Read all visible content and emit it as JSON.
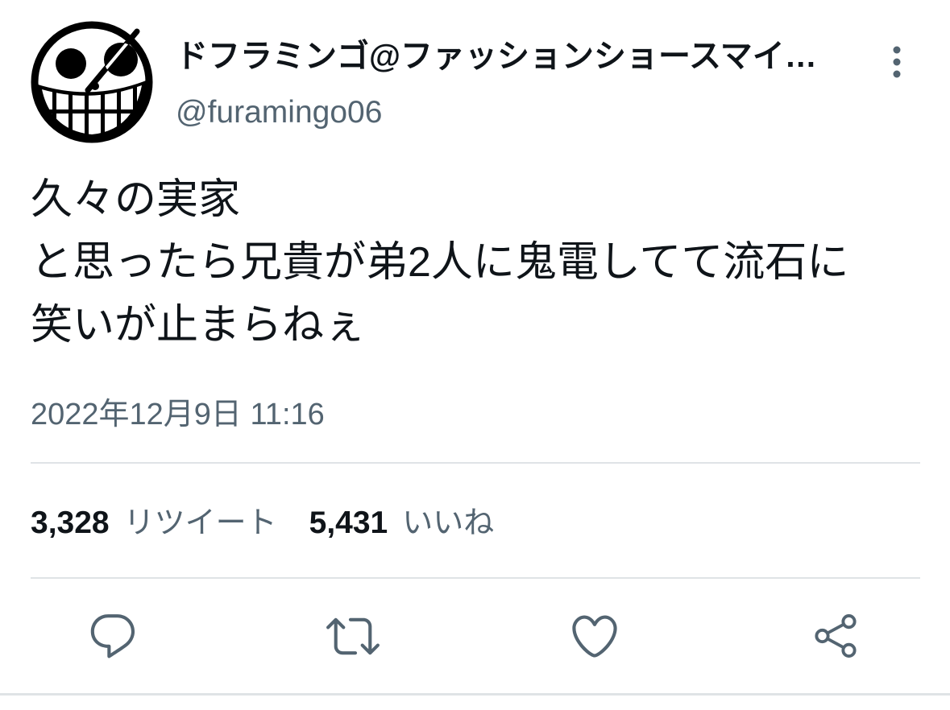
{
  "tweet": {
    "author": {
      "display_name": "ドフラミンゴ@ファッションショースマイ…",
      "handle": "@furamingo06",
      "avatar_icon": "grinning-skull-avatar"
    },
    "more_icon": "more-vertical-icon",
    "text_lines": [
      "久々の実家",
      "と思ったら兄貴が弟2人に鬼電してて流石に",
      "笑いが止まらねぇ"
    ],
    "timestamp": "2022年12月9日 11:16",
    "stats": [
      {
        "count": "3,328",
        "label": "リツイート"
      },
      {
        "count": "5,431",
        "label": "いいね"
      }
    ],
    "actions": [
      {
        "name": "reply",
        "icon": "reply-icon"
      },
      {
        "name": "retweet",
        "icon": "retweet-icon"
      },
      {
        "name": "like",
        "icon": "heart-icon"
      },
      {
        "name": "share",
        "icon": "share-icon"
      }
    ]
  },
  "colors": {
    "text": "#0f1419",
    "secondary": "#536471",
    "divider": "#dfe3e6",
    "background": "#ffffff"
  }
}
